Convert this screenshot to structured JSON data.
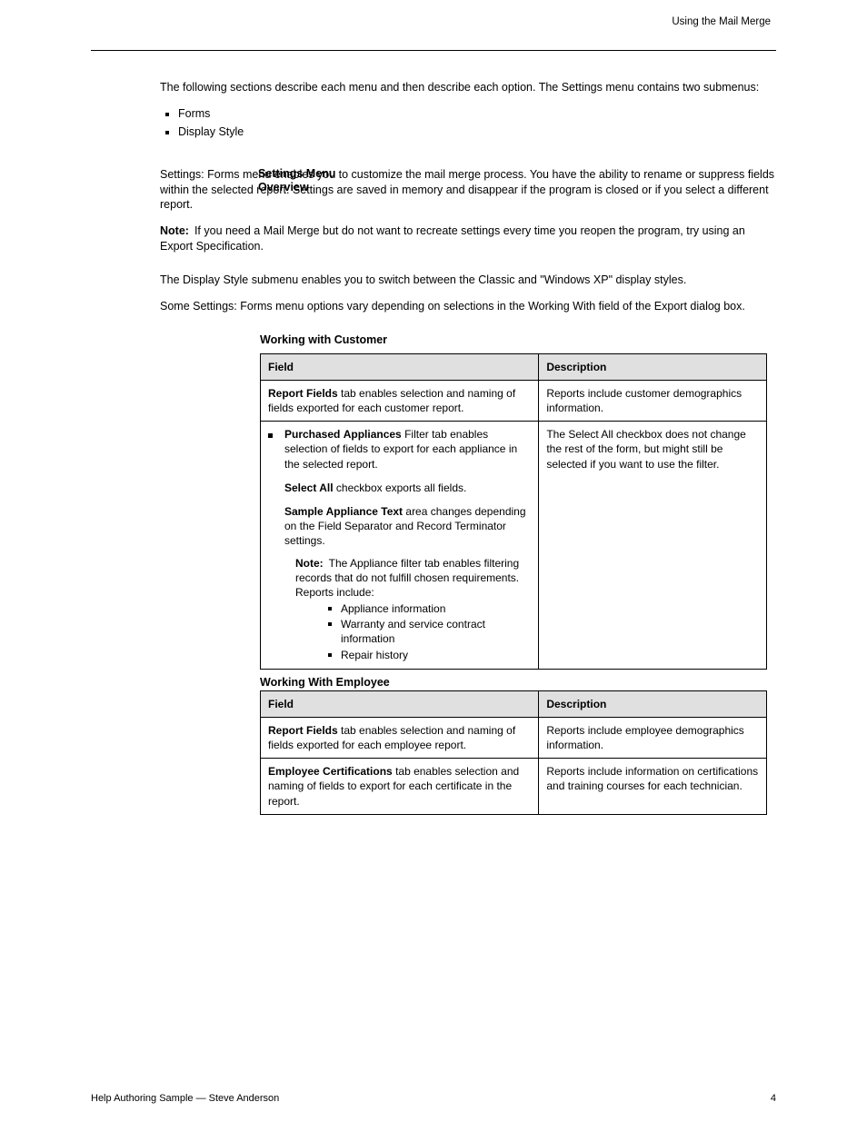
{
  "header": {
    "running_title": "Using the Mail Merge"
  },
  "intro": {
    "p1": "The following sections describe each menu and then describe each option. The Settings menu contains two submenus:",
    "bullets": [
      "Forms",
      "Display Style"
    ]
  },
  "settings_overview": {
    "side_label": "Settings Menu Overview",
    "p1": "Settings: Forms menu enables you to customize the mail merge process. You have the ability to rename or suppress fields within the selected report. Settings are saved in memory and disappear if the program is closed or if you select a different report.",
    "note_label": "Note:",
    "note_text": "If you need a Mail Merge but do not want to recreate settings every time you reopen the program, try using an Export Specification.",
    "p2": "The Display Style submenu enables you to switch between the Classic and \"Windows XP\" display styles.",
    "p3": "Some Settings: Forms menu options vary depending on selections in the Working With field of the Export dialog box."
  },
  "table_customer_title": "Working with Customer",
  "table_customer": {
    "headers": {
      "field": "Field",
      "description": "Description"
    },
    "rows": [
      {
        "field_name": "Report Fields",
        "field_text": "tab enables selection and naming of fields exported for each customer report.",
        "description": "Reports include customer demographics information."
      },
      {
        "field_bullet_lead": "Purchased Appliances Filter",
        "field_text_after_lead_word": "Filter tab enables selection of fields to export for each appliance in the selected report.",
        "sub1_label": "Select All",
        "sub1_text": "checkbox exports all fields.",
        "sub2_label": "Sample Appliance Text",
        "sub2_text": "area changes depending on the Field Separator and Record Terminator settings.",
        "note_label": "Note:",
        "note_text": "The Appliance filter tab enables filtering records that do not fulfill chosen requirements. Reports include:",
        "sublist": [
          "Appliance information",
          "Warranty and service contract information",
          "Repair history"
        ],
        "description": "The Select All checkbox does not change the rest of the form, but might still be selected if you want to use the filter."
      }
    ]
  },
  "table_employee_title": "Working With Employee",
  "table_employee": {
    "headers": {
      "field": "Field",
      "description": "Description"
    },
    "rows": [
      {
        "field_name": "Report Fields",
        "field_text": "tab enables selection and naming of fields exported for each employee report.",
        "description": "Reports include employee demographics information."
      },
      {
        "field_name": "Employee Certifications",
        "field_text": "tab enables selection and naming of fields to export for each certificate in the report.",
        "description": "Reports include information on certifications and training courses for each technician."
      }
    ]
  },
  "footer": {
    "left": "Help Authoring Sample — Steve Anderson",
    "right": "4"
  },
  "bullet_words": {
    "purchased": "Purchased",
    "appliances": "Appliances"
  }
}
